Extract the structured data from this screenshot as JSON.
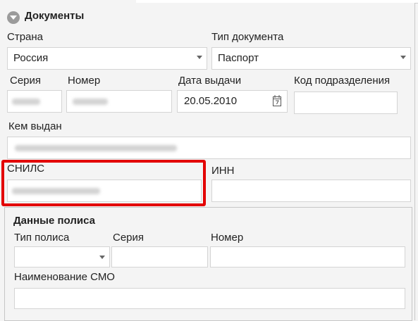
{
  "section": {
    "title": "Документы"
  },
  "country": {
    "label": "Страна",
    "value": "Россия"
  },
  "doc_type": {
    "label": "Тип документа",
    "value": "Паспорт"
  },
  "series": {
    "label": "Серия"
  },
  "number": {
    "label": "Номер"
  },
  "issue_date": {
    "label": "Дата выдачи",
    "value": "20.05.2010"
  },
  "division_code": {
    "label": "Код подразделения",
    "value": ""
  },
  "issued_by": {
    "label": "Кем выдан"
  },
  "snils": {
    "label": "СНИЛС"
  },
  "inn": {
    "label": "ИНН",
    "value": ""
  },
  "policy": {
    "title": "Данные полиса",
    "type_label": "Тип полиса",
    "series_label": "Серия",
    "number_label": "Номер",
    "smo_label": "Наименование СМО"
  },
  "colors": {
    "highlight": "#e30000",
    "field_bg": "#ffffff",
    "panel_bg": "#f4f4f4"
  },
  "icons": [
    "collapse-toggle-icon",
    "dropdown-arrow-icon",
    "calendar-icon"
  ]
}
